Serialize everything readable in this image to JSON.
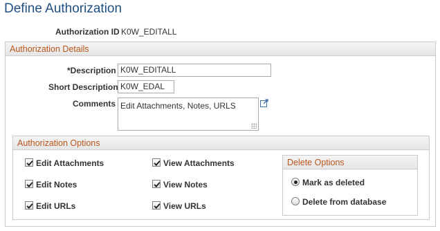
{
  "page": {
    "title": "Define Authorization"
  },
  "auth_id": {
    "label": "Authorization ID",
    "value": "K0W_EDITALL"
  },
  "details": {
    "header": "Authorization Details",
    "description": {
      "label": "*Description",
      "value": "K0W_EDITALL"
    },
    "short_description": {
      "label": "Short Description",
      "value": "K0W_EDAL"
    },
    "comments": {
      "label": "Comments",
      "value": "Edit Attachments, Notes, URLS"
    }
  },
  "options": {
    "header": "Authorization Options",
    "checkboxes": [
      {
        "label": "Edit Attachments",
        "checked": true
      },
      {
        "label": "Edit Notes",
        "checked": true
      },
      {
        "label": "Edit URLs",
        "checked": true
      },
      {
        "label": "View Attachments",
        "checked": true
      },
      {
        "label": "View Notes",
        "checked": true
      },
      {
        "label": "View URLs",
        "checked": true
      }
    ]
  },
  "delete_options": {
    "header": "Delete Options",
    "radios": [
      {
        "label": "Mark as deleted",
        "selected": true
      },
      {
        "label": "Delete from database",
        "selected": false
      }
    ]
  },
  "colors": {
    "title": "#1f4f80",
    "group_header": "#b9561a"
  },
  "icons": {
    "comments_expand": "popup-expand-icon",
    "checkmark": "checkmark-icon"
  }
}
